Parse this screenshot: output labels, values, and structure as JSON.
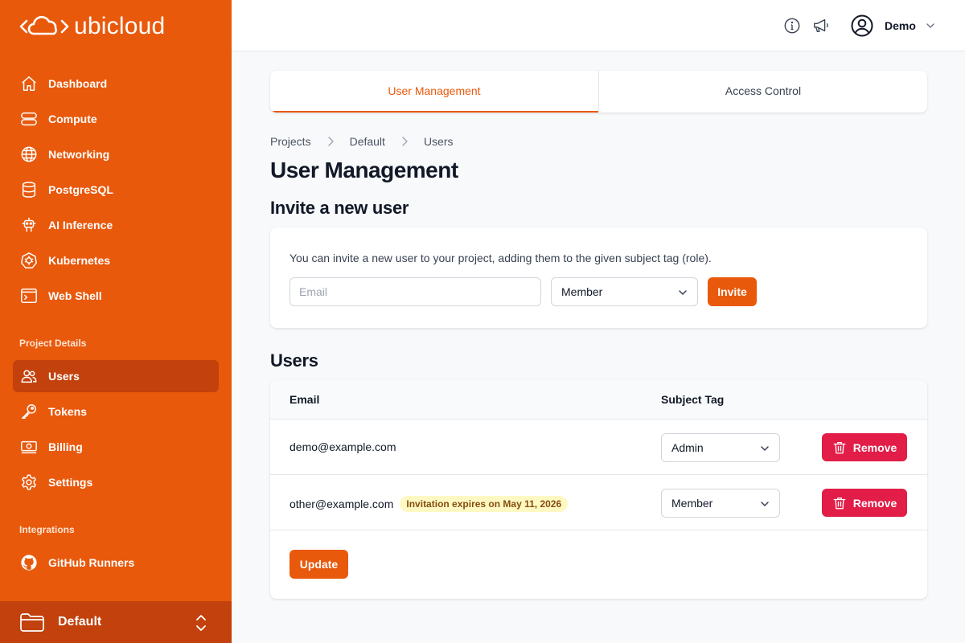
{
  "brand": {
    "name": "ubicloud",
    "accent": "#e8590c",
    "active_bg": "#c2410c",
    "danger": "#e11d48"
  },
  "sidebar": {
    "items": [
      {
        "label": "Dashboard",
        "icon": "home-icon"
      },
      {
        "label": "Compute",
        "icon": "server-icon"
      },
      {
        "label": "Networking",
        "icon": "globe-icon"
      },
      {
        "label": "PostgreSQL",
        "icon": "database-icon"
      },
      {
        "label": "AI Inference",
        "icon": "robot-icon"
      },
      {
        "label": "Kubernetes",
        "icon": "kubernetes-icon"
      },
      {
        "label": "Web Shell",
        "icon": "terminal-icon"
      }
    ],
    "project_details_title": "Project Details",
    "project_items": [
      {
        "label": "Users",
        "icon": "users-icon",
        "active": true
      },
      {
        "label": "Tokens",
        "icon": "key-icon"
      },
      {
        "label": "Billing",
        "icon": "billing-icon"
      },
      {
        "label": "Settings",
        "icon": "gear-icon"
      }
    ],
    "integrations_title": "Integrations",
    "integration_items": [
      {
        "label": "GitHub Runners",
        "icon": "github-icon"
      }
    ],
    "project_selector": "Default"
  },
  "header": {
    "user_name": "Demo",
    "icons": [
      "info-icon",
      "megaphone-icon",
      "user-circle-icon",
      "chevron-down-icon"
    ]
  },
  "tabs": [
    {
      "label": "User Management",
      "active": true
    },
    {
      "label": "Access Control",
      "active": false
    }
  ],
  "breadcrumb": [
    "Projects",
    "Default",
    "Users"
  ],
  "page_title": "User Management",
  "invite": {
    "title": "Invite a new user",
    "description": "You can invite a new user to your project, adding them to the given subject tag (role).",
    "email_placeholder": "Email",
    "role": "Member",
    "button": "Invite"
  },
  "users": {
    "title": "Users",
    "columns": [
      "Email",
      "Subject Tag"
    ],
    "rows": [
      {
        "email": "demo@example.com",
        "badge": "",
        "tag": "Admin",
        "action": "Remove"
      },
      {
        "email": "other@example.com",
        "badge": "Invitation expires on May 11, 2026",
        "tag": "Member",
        "action": "Remove"
      }
    ],
    "update_button": "Update"
  }
}
